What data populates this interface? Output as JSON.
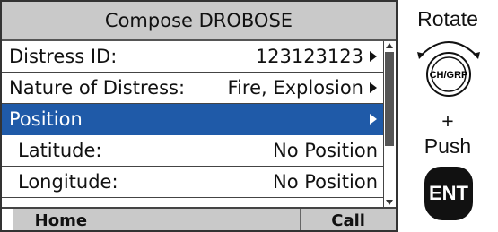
{
  "screen": {
    "title": "Compose DROBOSE",
    "rows": [
      {
        "label": "Distress ID:",
        "value": "123123123",
        "has_arrow": true
      },
      {
        "label": "Nature of Distress:",
        "value": "Fire, Explosion",
        "has_arrow": true
      },
      {
        "label": "Position",
        "value": "",
        "has_arrow": true,
        "selected": true
      },
      {
        "label": "Latitude:",
        "value": "No Position",
        "has_arrow": false
      },
      {
        "label": "Longitude:",
        "value": "No Position",
        "has_arrow": false
      }
    ],
    "softkeys": [
      "Home",
      "",
      "",
      "Call"
    ]
  },
  "instructions": {
    "rotate": "Rotate",
    "knob_label": "CH/GRP",
    "plus": "+",
    "push": "Push",
    "ent": "ENT"
  },
  "colors": {
    "selected_row": "#1f5aa8",
    "title_bar": "#c9c9c9"
  },
  "icons": {
    "row_arrow": "triangle-right-icon",
    "rotate_arrows": "curved-double-arrow-icon",
    "knob": "channel-knob-icon"
  }
}
